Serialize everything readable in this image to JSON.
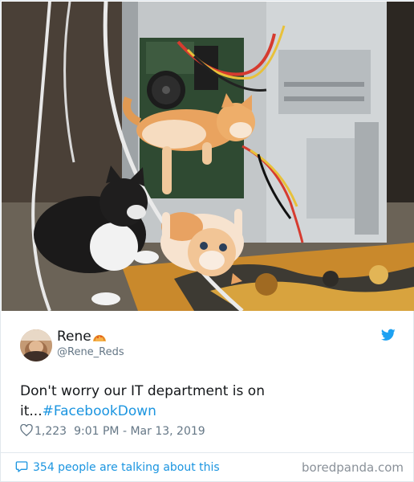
{
  "tweet": {
    "display_name": "Rene",
    "handle": "@Rene_Reds",
    "text_main": "Don't worry our IT department is on it...",
    "hashtag": "#FacebookDown",
    "likes": "1,223",
    "timestamp": "9:01 PM - Mar 13, 2019"
  },
  "footer": {
    "talking": "354 people are talking about this",
    "source": "boredpanda.com"
  },
  "icons": {
    "bird": "twitter-bird-icon",
    "heart": "heart-icon",
    "bubble": "speech-bubble-icon",
    "name_emoji": "taco-emoji-icon"
  },
  "colors": {
    "link_blue": "#1b95e0",
    "secondary_text": "#657786",
    "primary_text": "#14171a",
    "border": "#e1e8ed"
  }
}
